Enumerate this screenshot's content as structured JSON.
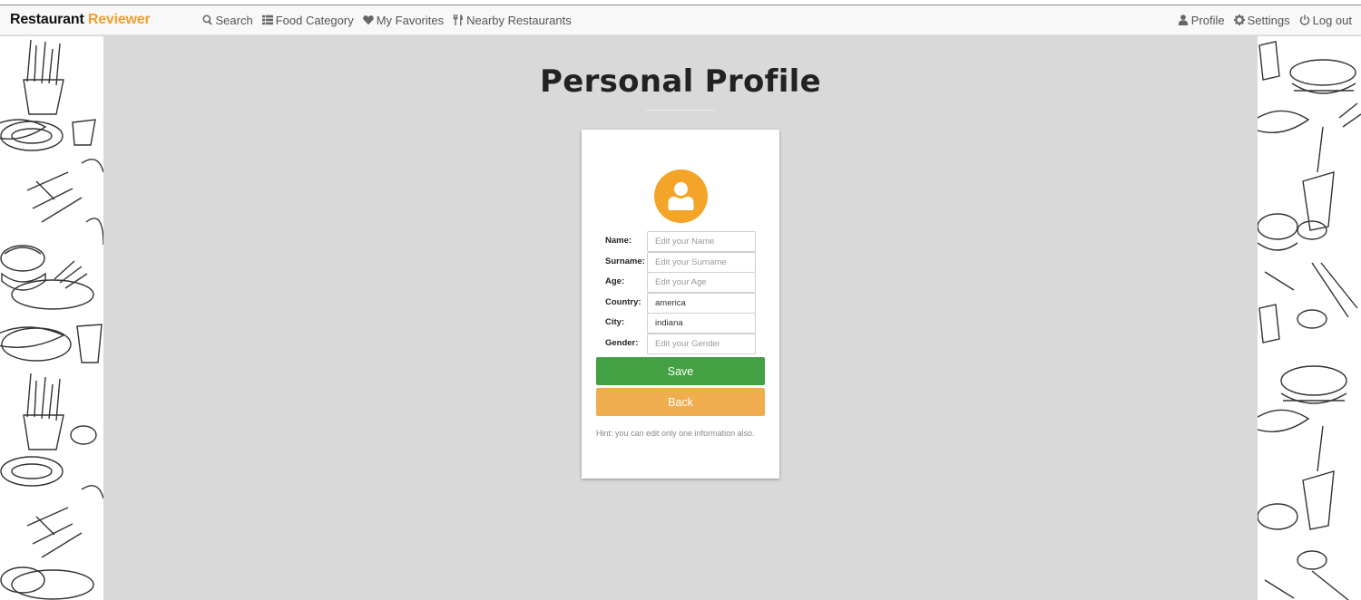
{
  "brand": {
    "name": "Restaurant",
    "accent": "Reviewer",
    "accent_color": "#f0a030"
  },
  "nav": {
    "left": [
      {
        "label": "Search",
        "icon": "search-icon"
      },
      {
        "label": "Food Category",
        "icon": "list-icon"
      },
      {
        "label": "My Favorites",
        "icon": "heart-icon"
      },
      {
        "label": "Nearby Restaurants",
        "icon": "cutlery-icon"
      }
    ],
    "right": [
      {
        "label": "Profile",
        "icon": "user-icon"
      },
      {
        "label": "Settings",
        "icon": "gear-icon"
      },
      {
        "label": "Log out",
        "icon": "power-icon"
      }
    ]
  },
  "page": {
    "title": "Personal Profile"
  },
  "profile": {
    "avatar_icon": "user-avatar-icon",
    "avatar_color": "#f4a428",
    "fields": [
      {
        "label": "Name:",
        "value": "",
        "placeholder": "Edit your Name"
      },
      {
        "label": "Surname:",
        "value": "",
        "placeholder": "Edit your Surname"
      },
      {
        "label": "Age:",
        "value": "",
        "placeholder": "Edit your Age"
      },
      {
        "label": "Country:",
        "value": "america",
        "placeholder": ""
      },
      {
        "label": "City:",
        "value": "indiana",
        "placeholder": ""
      },
      {
        "label": "Gender:",
        "value": "",
        "placeholder": "Edit your Gender"
      }
    ],
    "save_label": "Save",
    "save_color": "#43a143",
    "back_label": "Back",
    "back_color": "#f0ad4e",
    "hint": "Hint: you can edit only one information also."
  }
}
